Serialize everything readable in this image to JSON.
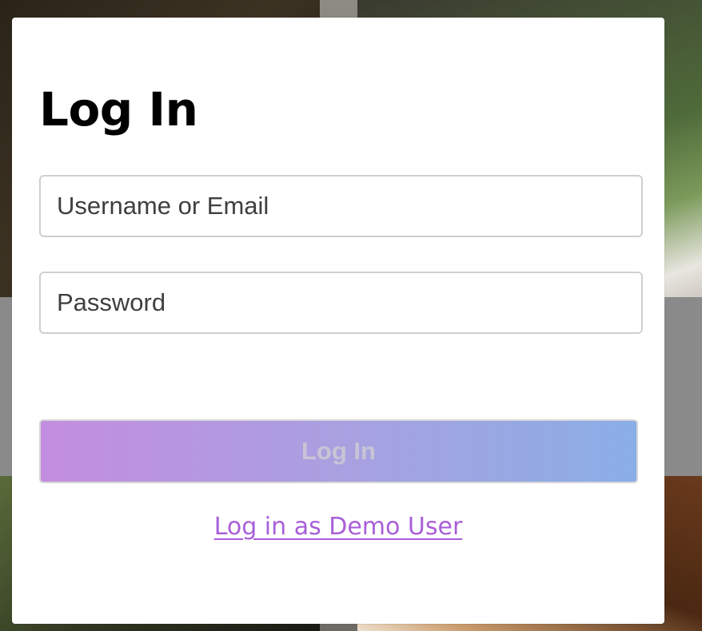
{
  "login_modal": {
    "title": "Log In",
    "username_field": {
      "placeholder": "Username or Email",
      "value": ""
    },
    "password_field": {
      "placeholder": "Password",
      "value": ""
    },
    "submit_label": "Log In",
    "demo_link_label": "Log in as Demo User"
  },
  "colors": {
    "button_gradient_start": "#c38de0",
    "button_gradient_end": "#8aaee6",
    "link": "#a85fd8"
  }
}
